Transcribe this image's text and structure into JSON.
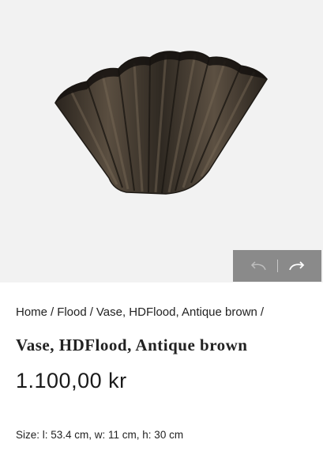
{
  "gallery": {
    "image_alt": "Vase, HDFlood, Antique brown",
    "prev_icon": "undo-arrow-icon",
    "next_icon": "redo-arrow-icon"
  },
  "breadcrumb": {
    "items": [
      "Home",
      "Flood",
      "Vase, HDFlood, Antique brown"
    ],
    "separator": "/"
  },
  "product": {
    "title": "Vase, HDFlood, Antique brown",
    "price": "1.100,00 kr",
    "size": "Size: l: 53.4 cm, w: 11 cm, h: 30 cm"
  },
  "colors": {
    "image_bg": "#f2f2f2",
    "nav_bg": "#8a8a8a",
    "vase": "#3b342c"
  }
}
